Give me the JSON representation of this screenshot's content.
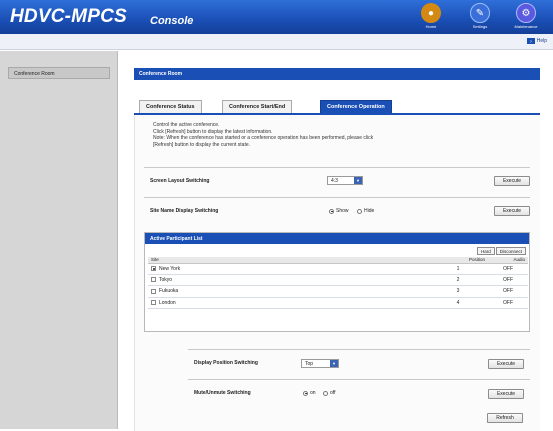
{
  "header": {
    "brand": "HDVC-MPCS",
    "subtitle": "Console",
    "icons": [
      {
        "name": "home-icon",
        "label": "Home",
        "color": "#d48a12"
      },
      {
        "name": "settings-icon",
        "label": "Settings",
        "color": "#3a6ed8"
      },
      {
        "name": "maintenance-icon",
        "label": "Maintenance",
        "color": "#5a5ae0"
      }
    ],
    "help_label": "Help"
  },
  "sidebar": {
    "items": [
      {
        "label": "Conference Room"
      }
    ]
  },
  "main": {
    "section_title": "Conference Room",
    "tabs": [
      {
        "label": "Conference Status",
        "active": false
      },
      {
        "label": "Conference Start/End",
        "active": false
      },
      {
        "label": "Conference Operation",
        "active": true
      }
    ],
    "info": [
      "Control the active conference.",
      "Click [Refresh] button to display the latest information.",
      "Note: When the conference has started or a conference operation has been performed, please click",
      "[Refresh] button to display the current state."
    ],
    "screen_layout": {
      "label": "Screen Layout Switching",
      "value": "4:3",
      "button": "Execute"
    },
    "site_name": {
      "label": "Site Name Display Switching",
      "options": [
        "Show",
        "Hide"
      ],
      "selected": "Show",
      "button": "Execute"
    },
    "participant_list": {
      "title": "Active Participant List",
      "tools": [
        "Hard",
        "Disconnect"
      ],
      "columns": [
        "Site",
        "Position",
        "Audio"
      ],
      "rows": [
        {
          "site": "New York",
          "position": "1",
          "audio": "OFF",
          "checked": true
        },
        {
          "site": "Tokyo",
          "position": "2",
          "audio": "OFF",
          "checked": false
        },
        {
          "site": "Fukuoka",
          "position": "3",
          "audio": "OFF",
          "checked": false
        },
        {
          "site": "London",
          "position": "4",
          "audio": "OFF",
          "checked": false
        }
      ]
    },
    "display_position": {
      "label": "Display Position Switching",
      "value": "Top",
      "button": "Execute"
    },
    "mute": {
      "label": "Mute/Unmute Switching",
      "options": [
        "on",
        "off"
      ],
      "selected": "on",
      "button": "Execute"
    },
    "refresh_button": "Refresh"
  },
  "colors": {
    "accent": "#1a4fb5",
    "sidebar_bg": "#d6d6d6"
  }
}
